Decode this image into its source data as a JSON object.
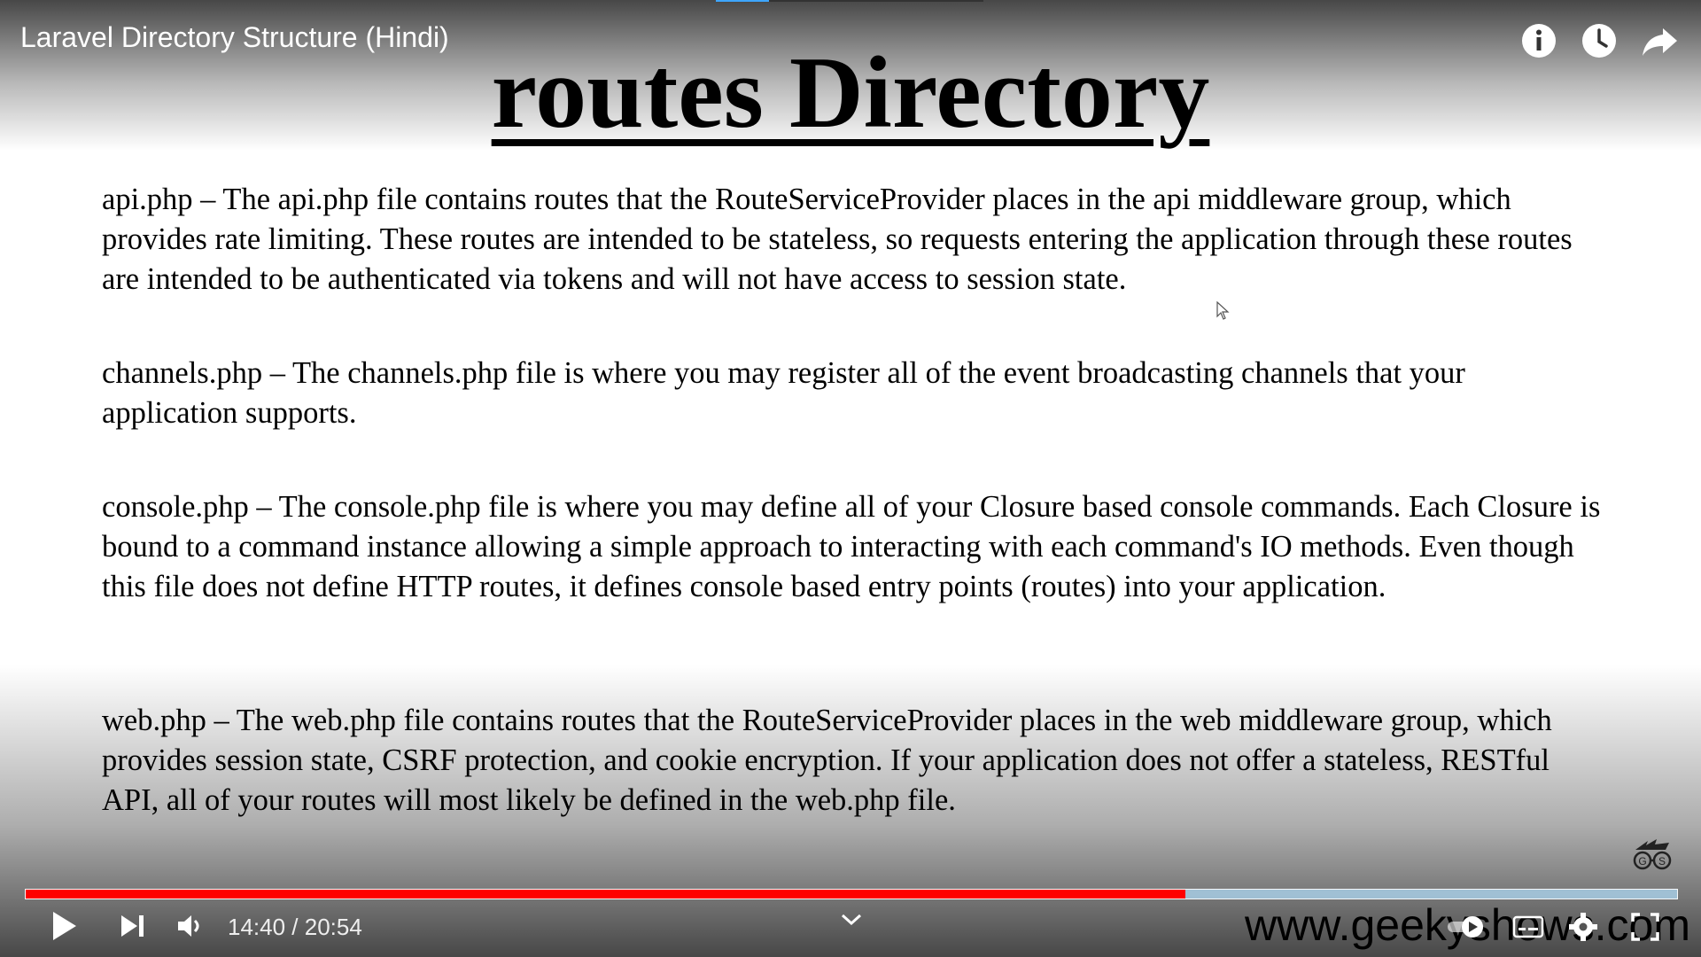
{
  "player": {
    "video_title": "Laravel Directory Structure (Hindi)",
    "current_time": "14:40",
    "duration": "20:54",
    "time_display": "14:40 / 20:54",
    "progress_fraction": 0.702,
    "colors": {
      "progress": "#ff0000",
      "buffer": "#aad2eb",
      "accent": "#3ea6ff"
    },
    "icons": {
      "info": "info-icon",
      "watch_later": "clock-icon",
      "share": "share-icon",
      "play": "play-icon",
      "next": "skip-next-icon",
      "volume": "volume-icon",
      "chevron": "chevron-down-icon",
      "autoplay": "autoplay-toggle-icon",
      "subtitles": "subtitles-icon",
      "settings": "gear-icon",
      "fullscreen": "fullscreen-icon"
    }
  },
  "slide": {
    "title": "routes Directory",
    "paragraphs": [
      "api.php – The api.php file contains routes that the RouteServiceProvider places in the api middleware group, which provides rate limiting. These routes are intended to be stateless, so requests entering the application through these routes are intended to be authenticated via tokens and will not have access to session state.",
      "channels.php – The channels.php file is where you may register all of the event broadcasting channels that your application supports.",
      "console.php – The console.php file is where you may define all of your Closure based console commands. Each Closure is bound to a command instance allowing a simple approach to interacting with each command's IO methods. Even though this file does not define HTTP routes, it defines console based entry points (routes) into your application.",
      "web.php – The web.php file contains routes that the RouteServiceProvider places in the web middleware group, which provides session state, CSRF protection, and cookie encryption. If your application does not offer a stateless, RESTful API, all of your routes will most likely be defined in the web.php file."
    ],
    "watermark": "www.geekyshows.com",
    "logo_text": "GS"
  }
}
